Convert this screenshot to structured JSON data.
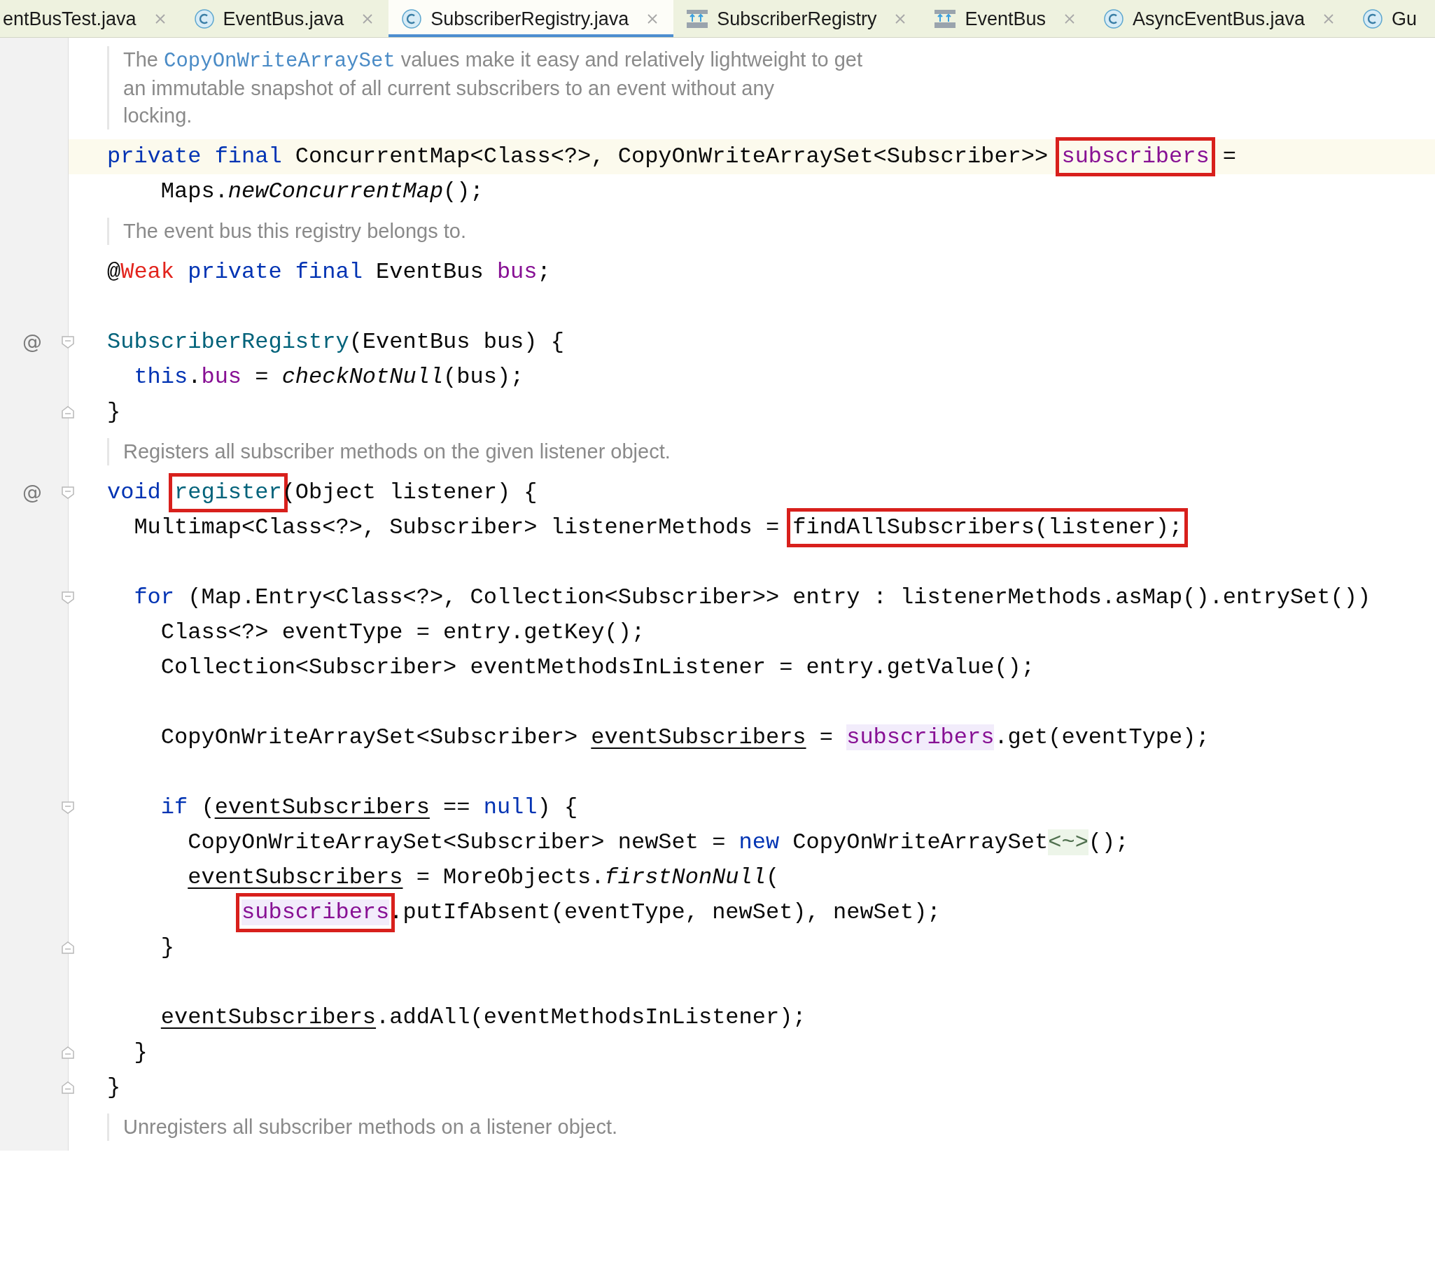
{
  "tabs": [
    {
      "label": "entBusTest.java",
      "kind": "partial",
      "selected": false
    },
    {
      "label": "EventBus.java",
      "kind": "class",
      "selected": false
    },
    {
      "label": "SubscriberRegistry.java",
      "kind": "class",
      "selected": true
    },
    {
      "label": "SubscriberRegistry",
      "kind": "diagram",
      "selected": false
    },
    {
      "label": "EventBus",
      "kind": "diagram",
      "selected": false
    },
    {
      "label": "AsyncEventBus.java",
      "kind": "class",
      "selected": false
    },
    {
      "label": "Gu",
      "kind": "class-cut",
      "selected": false
    }
  ],
  "items": [
    {
      "kind": "doc",
      "lines": [
        [
          {
            "text": "The ",
            "kind": "text"
          },
          {
            "text": "CopyOnWriteArraySet",
            "kind": "code"
          },
          {
            "text": " values make it easy and relatively lightweight to get",
            "kind": "text"
          }
        ],
        [
          {
            "text": "an immutable snapshot of all current subscribers to an event without any",
            "kind": "text"
          }
        ],
        [
          {
            "text": "locking.",
            "kind": "text"
          }
        ]
      ]
    },
    {
      "kind": "code",
      "current": true,
      "fold_start": false,
      "fold_end": false,
      "tokens": [
        {
          "text": "private final ",
          "kind": "keyword"
        },
        {
          "text": "ConcurrentMap<Class<?>, CopyOnWriteArraySet<Subscriber>> ",
          "kind": "plain"
        },
        {
          "text": "subscribers",
          "kind": "field",
          "boxed": true
        },
        {
          "text": " =",
          "kind": "plain"
        }
      ]
    },
    {
      "kind": "code",
      "current": false,
      "fold_start": false,
      "fold_end": false,
      "tokens": [
        {
          "text": "    Maps.",
          "kind": "plain"
        },
        {
          "text": "newConcurrentMap",
          "kind": "static"
        },
        {
          "text": "();",
          "kind": "plain"
        }
      ]
    },
    {
      "kind": "doc",
      "lines": [
        [
          {
            "text": "The event bus this registry belongs to.",
            "kind": "text"
          }
        ]
      ]
    },
    {
      "kind": "code",
      "current": false,
      "fold_start": false,
      "fold_end": false,
      "tokens": [
        {
          "text": "@",
          "kind": "plain"
        },
        {
          "text": "Weak",
          "kind": "annotation"
        },
        {
          "text": " private final ",
          "kind": "keyword"
        },
        {
          "text": "EventBus ",
          "kind": "plain"
        },
        {
          "text": "bus",
          "kind": "field"
        },
        {
          "text": ";",
          "kind": "plain"
        }
      ]
    },
    {
      "kind": "blank"
    },
    {
      "kind": "code",
      "current": false,
      "gutter": "@",
      "fold_start": true,
      "fold_end": false,
      "tokens": [
        {
          "text": "SubscriberRegistry",
          "kind": "decl"
        },
        {
          "text": "(EventBus bus) {",
          "kind": "plain"
        }
      ]
    },
    {
      "kind": "code",
      "current": false,
      "fold_start": false,
      "fold_end": false,
      "tokens": [
        {
          "text": "  this",
          "kind": "keyword"
        },
        {
          "text": ".",
          "kind": "plain"
        },
        {
          "text": "bus",
          "kind": "field"
        },
        {
          "text": " = ",
          "kind": "plain"
        },
        {
          "text": "checkNotNull",
          "kind": "static"
        },
        {
          "text": "(bus);",
          "kind": "plain"
        }
      ]
    },
    {
      "kind": "code",
      "current": false,
      "fold_start": false,
      "fold_end": true,
      "tokens": [
        {
          "text": "}",
          "kind": "plain"
        }
      ]
    },
    {
      "kind": "doc",
      "lines": [
        [
          {
            "text": "Registers all subscriber methods on the given listener object.",
            "kind": "text"
          }
        ]
      ]
    },
    {
      "kind": "code",
      "current": false,
      "gutter": "@",
      "fold_start": true,
      "fold_end": false,
      "tokens": [
        {
          "text": "void ",
          "kind": "keyword"
        },
        {
          "text": "register",
          "kind": "decl",
          "boxed": true
        },
        {
          "text": "(Object listener) {",
          "kind": "plain"
        }
      ]
    },
    {
      "kind": "code",
      "current": false,
      "fold_start": false,
      "fold_end": false,
      "tokens": [
        {
          "text": "  Multimap<Class<?>, Subscriber> listenerMethods = ",
          "kind": "plain"
        },
        {
          "text": "findAllSubscribers(listener);",
          "kind": "plain",
          "boxed": true
        }
      ]
    },
    {
      "kind": "blank"
    },
    {
      "kind": "code",
      "current": false,
      "fold_start": true,
      "fold_end": false,
      "tokens": [
        {
          "text": "  for",
          "kind": "keyword"
        },
        {
          "text": " (Map.Entry<Class<?>, Collection<Subscriber>> entry : listenerMethods.asMap().entrySet())",
          "kind": "plain"
        }
      ]
    },
    {
      "kind": "code",
      "current": false,
      "fold_start": false,
      "fold_end": false,
      "tokens": [
        {
          "text": "    Class<?> eventType = entry.getKey();",
          "kind": "plain"
        }
      ]
    },
    {
      "kind": "code",
      "current": false,
      "fold_start": false,
      "fold_end": false,
      "tokens": [
        {
          "text": "    Collection<Subscriber> eventMethodsInListener = entry.getValue();",
          "kind": "plain"
        }
      ]
    },
    {
      "kind": "blank"
    },
    {
      "kind": "code",
      "current": false,
      "fold_start": false,
      "fold_end": false,
      "tokens": [
        {
          "text": "    CopyOnWriteArraySet<Subscriber> ",
          "kind": "plain"
        },
        {
          "text": "eventSubscribers",
          "kind": "reassigned"
        },
        {
          "text": " = ",
          "kind": "plain"
        },
        {
          "text": "subscribers",
          "kind": "field",
          "highlighted": true
        },
        {
          "text": ".get(eventType);",
          "kind": "plain"
        }
      ]
    },
    {
      "kind": "blank"
    },
    {
      "kind": "code",
      "current": false,
      "fold_start": true,
      "fold_end": false,
      "tokens": [
        {
          "text": "    if",
          "kind": "keyword"
        },
        {
          "text": " (",
          "kind": "plain"
        },
        {
          "text": "eventSubscribers",
          "kind": "reassigned"
        },
        {
          "text": " == ",
          "kind": "plain"
        },
        {
          "text": "null",
          "kind": "keyword"
        },
        {
          "text": ") {",
          "kind": "plain"
        }
      ]
    },
    {
      "kind": "code",
      "current": false,
      "fold_start": false,
      "fold_end": false,
      "tokens": [
        {
          "text": "      CopyOnWriteArraySet<Subscriber> newSet = ",
          "kind": "plain"
        },
        {
          "text": "new",
          "kind": "keyword"
        },
        {
          "text": " CopyOnWriteArraySet",
          "kind": "plain"
        },
        {
          "text": "<~>",
          "kind": "hint"
        },
        {
          "text": "();",
          "kind": "plain"
        }
      ]
    },
    {
      "kind": "code",
      "current": false,
      "fold_start": false,
      "fold_end": false,
      "tokens": [
        {
          "text": "      eventSubscribers",
          "kind": "reassigned"
        },
        {
          "text": " = MoreObjects.",
          "kind": "plain"
        },
        {
          "text": "firstNonNull",
          "kind": "static"
        },
        {
          "text": "(",
          "kind": "plain"
        }
      ]
    },
    {
      "kind": "code",
      "current": false,
      "fold_start": false,
      "fold_end": false,
      "tokens": [
        {
          "text": "          subscribers",
          "kind": "field",
          "highlighted": true,
          "boxed": true
        },
        {
          "text": ".putIfAbsent(eventType, newSet), newSet);",
          "kind": "plain"
        }
      ]
    },
    {
      "kind": "code",
      "current": false,
      "fold_start": false,
      "fold_end": true,
      "tokens": [
        {
          "text": "    }",
          "kind": "plain"
        }
      ]
    },
    {
      "kind": "blank"
    },
    {
      "kind": "code",
      "current": false,
      "fold_start": false,
      "fold_end": false,
      "tokens": [
        {
          "text": "    eventSubscribers",
          "kind": "reassigned"
        },
        {
          "text": ".addAll(eventMethodsInListener);",
          "kind": "plain"
        }
      ]
    },
    {
      "kind": "code",
      "current": false,
      "fold_start": false,
      "fold_end": true,
      "tokens": [
        {
          "text": "  }",
          "kind": "plain"
        }
      ]
    },
    {
      "kind": "code",
      "current": false,
      "fold_start": false,
      "fold_end": true,
      "tokens": [
        {
          "text": "}",
          "kind": "plain"
        }
      ]
    },
    {
      "kind": "doc",
      "lines": [
        [
          {
            "text": "Unregisters all subscriber methods on a listener object.",
            "kind": "text"
          }
        ]
      ]
    }
  ]
}
